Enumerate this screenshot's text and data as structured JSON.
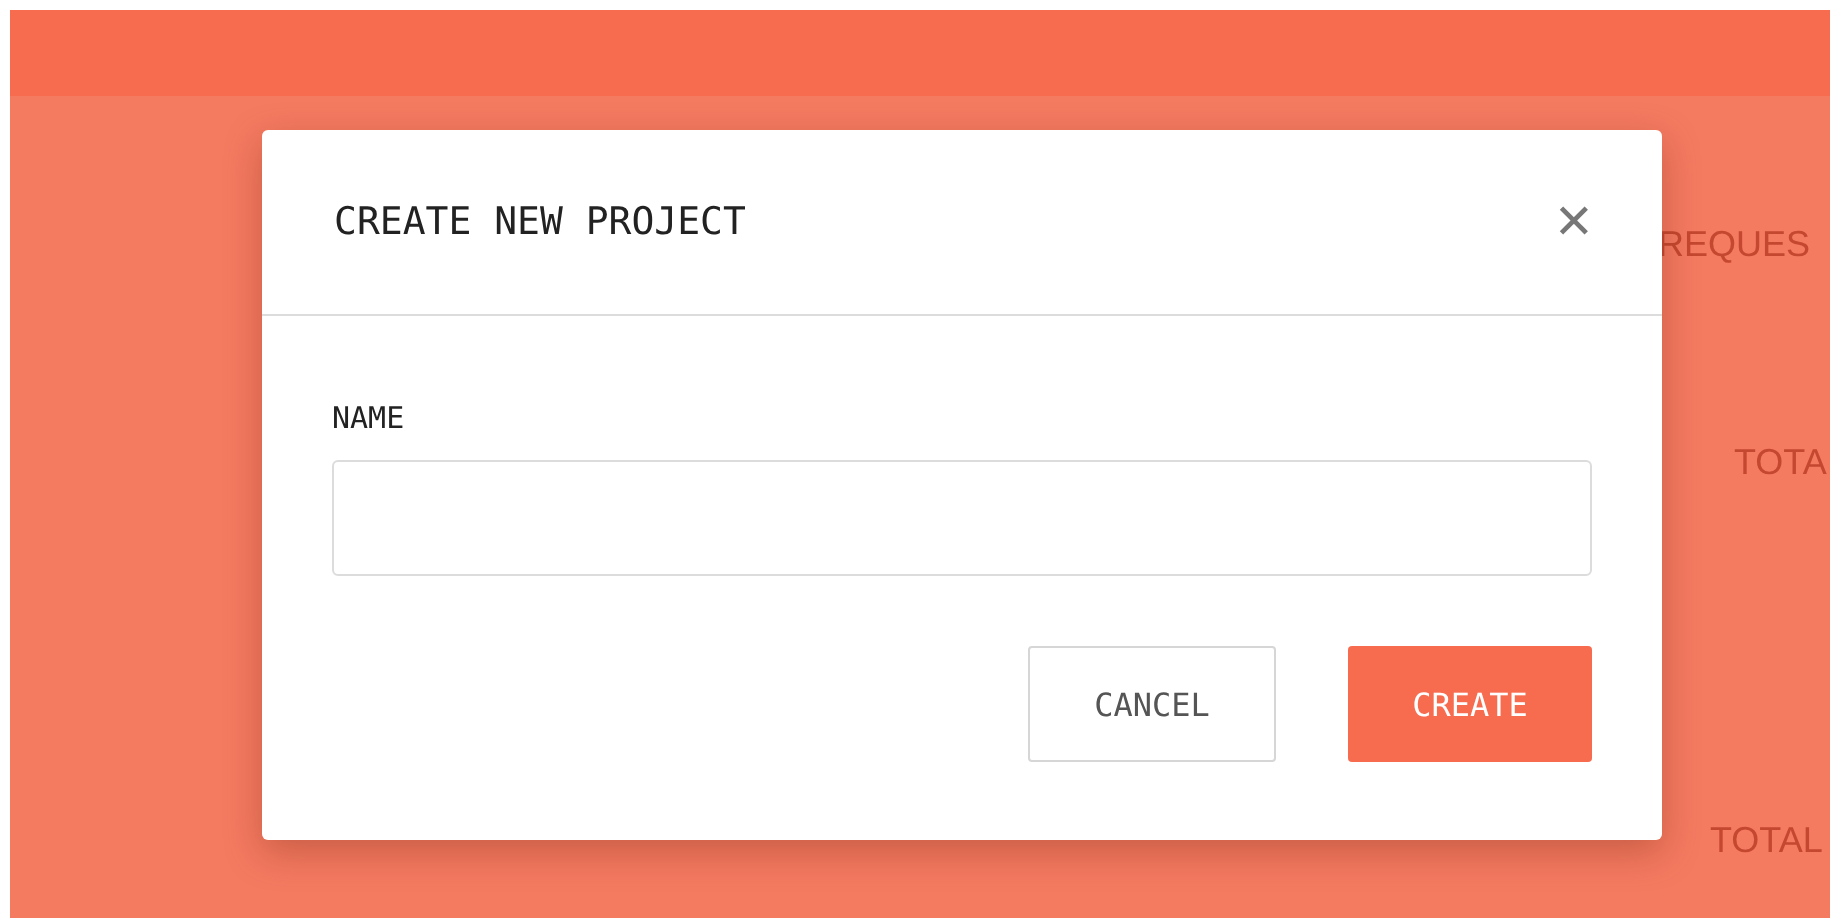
{
  "background": {
    "labels": [
      {
        "text": "REQUES"
      },
      {
        "text": "TOTA"
      },
      {
        "text": "TOTAL"
      }
    ]
  },
  "dialog": {
    "title": "CREATE NEW PROJECT",
    "close": "✕",
    "fields": [
      {
        "label": "NAME"
      }
    ],
    "buttons": [
      {
        "label": "CANCEL",
        "kind": "secondary"
      },
      {
        "label": "CREATE",
        "kind": "primary"
      }
    ]
  }
}
